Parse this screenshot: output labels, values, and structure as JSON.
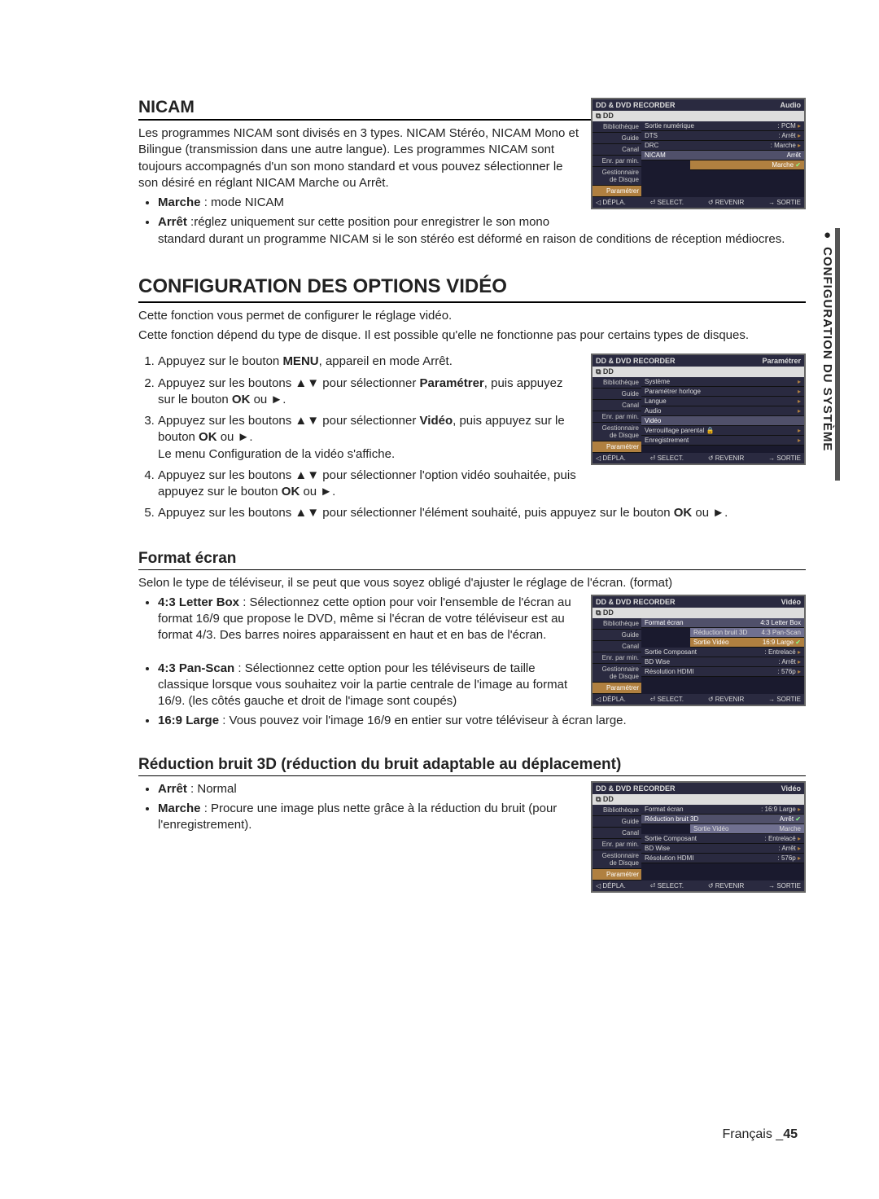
{
  "sideTab": "●  CONFIGURATION DU SYSTÈME",
  "footer": {
    "lang": "Français _",
    "page": "45"
  },
  "nicam": {
    "title": "NICAM",
    "intro": "Les programmes NICAM sont divisés en 3 types. NICAM Stéréo, NICAM Mono et Bilingue (transmission dans une autre langue). Les programmes NICAM sont toujours accompagnés d'un son mono standard et vous pouvez sélectionner le son désiré en réglant NICAM Marche ou Arrêt.",
    "bullets": [
      {
        "bold": "Marche",
        "rest": " : mode NICAM"
      },
      {
        "bold": "Arrêt",
        "rest": " :réglez uniquement sur cette position pour enregistrer le son mono standard durant un programme NICAM si le son stéréo est déformé en raison de conditions de réception médiocres."
      }
    ]
  },
  "config": {
    "title": "CONFIGURATION DES OPTIONS VIDÉO",
    "intro1": "Cette fonction vous permet de configurer le réglage vidéo.",
    "intro2": "Cette fonction dépend du type de disque. Il est possible qu'elle ne fonctionne pas pour certains types de disques.",
    "steps": [
      {
        "pre": "Appuyez sur le bouton ",
        "b": "MENU",
        "post": ", appareil en mode Arrêt."
      },
      {
        "pre": "Appuyez sur les boutons ▲▼ pour sélectionner ",
        "b": "Paramétrer",
        "post": ", puis appuyez sur le bouton ",
        "b2": "OK",
        "post2": " ou ►."
      },
      {
        "pre": "Appuyez sur les boutons ▲▼ pour sélectionner ",
        "b": "Vidéo",
        "post": ", puis appuyez sur le bouton ",
        "b2": "OK",
        "post2": " ou ►.\nLe menu Configuration de la vidéo s'affiche."
      },
      {
        "pre": "Appuyez sur les boutons ▲▼ pour sélectionner l'option vidéo souhaitée, puis appuyez sur le bouton ",
        "b": "OK",
        "post": " ou ►."
      },
      {
        "pre": "Appuyez sur les boutons ▲▼ pour sélectionner l'élément souhaité, puis appuyez sur le bouton ",
        "b": "OK",
        "post": " ou ►."
      }
    ]
  },
  "format": {
    "title": "Format écran",
    "intro": "Selon le type de téléviseur, il se peut que vous soyez obligé d'ajuster le réglage de l'écran. (format)",
    "b1": {
      "bold": "4:3 Letter Box",
      "rest": " : Sélectionnez cette option pour voir l'ensemble de l'écran au format 16/9 que propose le DVD, même si l'écran de votre téléviseur est au format 4/3. Des barres noires apparaissent en haut et en bas de l'écran."
    },
    "b2": {
      "bold": "4:3 Pan-Scan",
      "rest": " : Sélectionnez cette option pour les téléviseurs de taille classique lorsque vous souhaitez voir la partie centrale de l'image au format 16/9. (les côtés gauche et droit de l'image sont coupés)"
    },
    "b3": {
      "bold": "16:9 Large",
      "rest": " : Vous pouvez voir l'image 16/9 en entier sur votre téléviseur à écran large."
    }
  },
  "nr3d": {
    "title": "Réduction bruit 3D (réduction du bruit adaptable au déplacement)",
    "b1": {
      "bold": "Arrêt",
      "rest": " : Normal"
    },
    "b2": {
      "bold": "Marche",
      "rest": " : Procure une image plus nette grâce à la réduction du bruit (pour l'enregistrement)."
    }
  },
  "osd_common": {
    "header": "DD & DVD RECORDER",
    "subhdr": "⧉ DD",
    "nav": [
      "Bibliothèque",
      "Guide",
      "Canal",
      "Enr. par min.",
      "Gestionnaire de Disque",
      "Paramétrer"
    ],
    "foot": [
      "◁ DÉPLA.",
      "⏎ SELECT.",
      "↺ REVENIR",
      "→ SORTIE"
    ]
  },
  "osd1": {
    "corner": "Audio",
    "rows": [
      [
        "Sortie numérique",
        ": PCM",
        "chev"
      ],
      [
        "DTS",
        ": Arrêt",
        "chev"
      ],
      [
        "DRC",
        ": Marche",
        "chev"
      ],
      [
        "NICAM",
        "Arrêt",
        "hi"
      ],
      [
        "",
        "Marche",
        "sub-sel"
      ]
    ]
  },
  "osd2": {
    "corner": "Paramétrer",
    "rows": [
      [
        "Système",
        "",
        "chev"
      ],
      [
        "Paramétrer horloge",
        "",
        "chev"
      ],
      [
        "Langue",
        "",
        "chev"
      ],
      [
        "Audio",
        "",
        "chev"
      ],
      [
        "Vidéo",
        "",
        "hi"
      ],
      [
        "Verrouillage parental 🔒",
        "",
        "chev"
      ],
      [
        "Enregistrement",
        "",
        "chev"
      ]
    ]
  },
  "osd3": {
    "corner": "Vidéo",
    "rows": [
      [
        "Format écran",
        "4:3 Letter Box",
        "hi"
      ],
      [
        "Réduction bruit 3D",
        "4:3 Pan-Scan",
        "sub-opt"
      ],
      [
        "Sortie Vidéo",
        "16:9 Large",
        "sub-sel"
      ],
      [
        "Sortie Composant",
        ": Entrelacé",
        "chev"
      ],
      [
        "BD Wise",
        ": Arrêt",
        "chev"
      ],
      [
        "Résolution HDMI",
        ": 576p",
        "chev"
      ]
    ]
  },
  "osd4": {
    "corner": "Vidéo",
    "rows": [
      [
        "Format écran",
        ": 16:9 Large",
        "chev"
      ],
      [
        "Réduction bruit 3D",
        "Arrêt",
        "hi"
      ],
      [
        "Sortie Vidéo",
        "Marche",
        "sub-opt"
      ],
      [
        "Sortie Composant",
        ": Entrelacé",
        "chev"
      ],
      [
        "BD Wise",
        ": Arrêt",
        "chev"
      ],
      [
        "Résolution HDMI",
        ": 576p",
        "chev"
      ]
    ],
    "selCheck": 1
  }
}
